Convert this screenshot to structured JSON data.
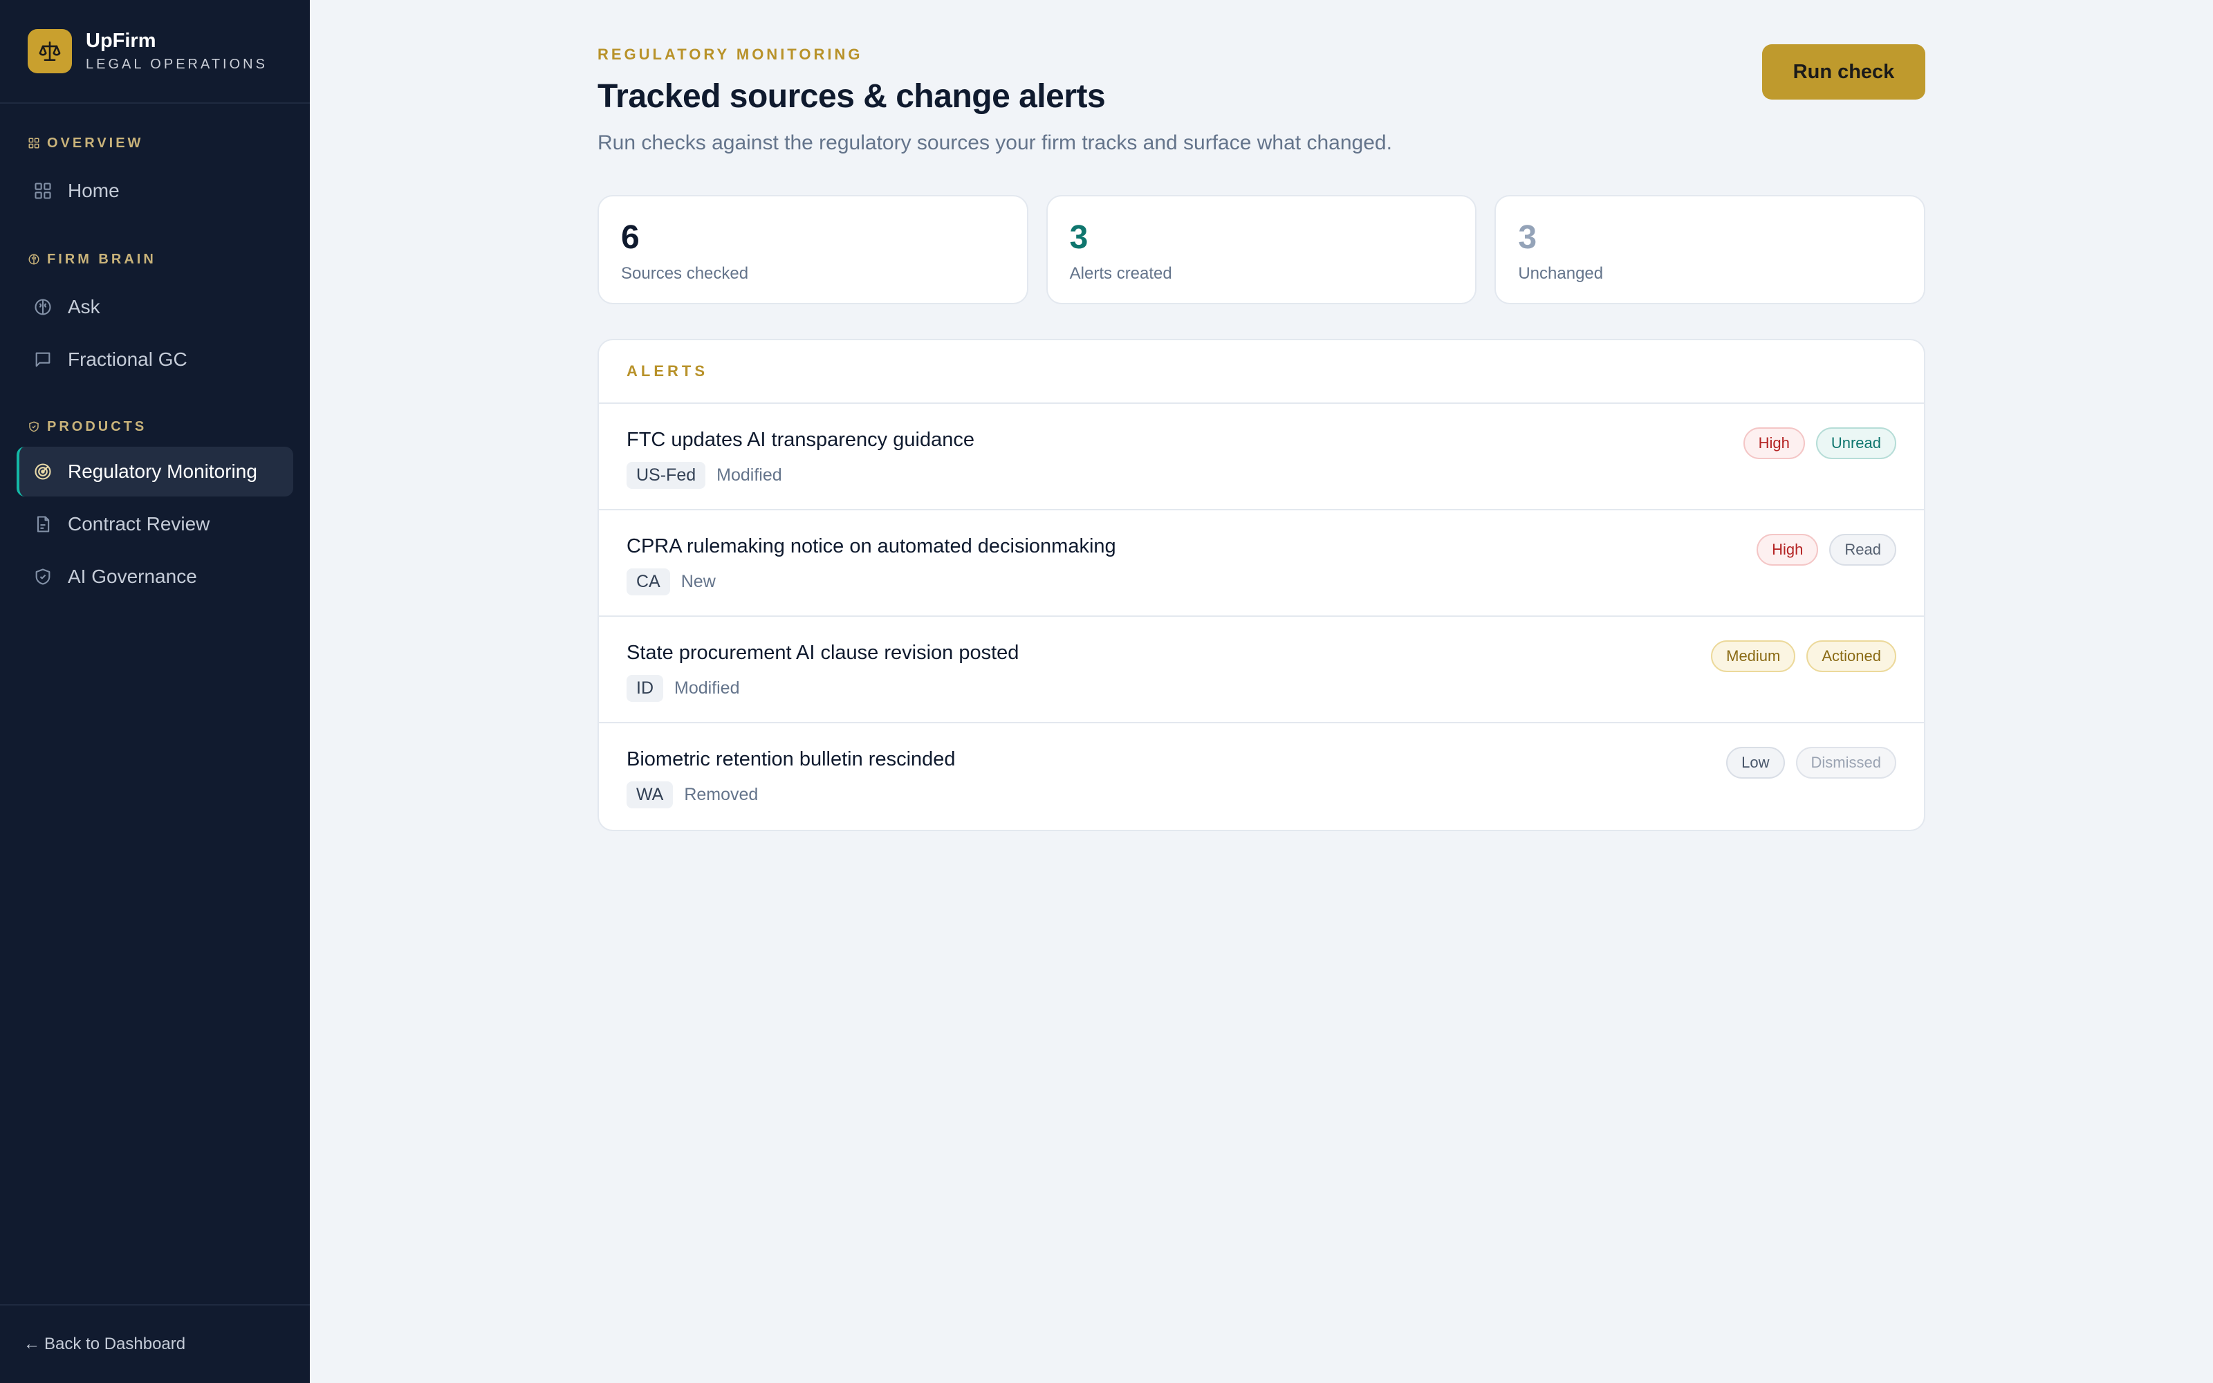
{
  "brand": {
    "name": "UpFirm",
    "subtitle": "LEGAL OPERATIONS"
  },
  "sidebar": {
    "sections": [
      {
        "header": "OVERVIEW",
        "items": [
          {
            "label": "Home",
            "icon": "grid-icon"
          }
        ]
      },
      {
        "header": "FIRM BRAIN",
        "items": [
          {
            "label": "Ask",
            "icon": "brain-icon"
          },
          {
            "label": "Fractional GC",
            "icon": "chat-icon"
          }
        ]
      },
      {
        "header": "PRODUCTS",
        "items": [
          {
            "label": "Regulatory Monitoring",
            "icon": "radar-icon",
            "active": true
          },
          {
            "label": "Contract Review",
            "icon": "document-icon"
          },
          {
            "label": "AI Governance",
            "icon": "shield-check-icon"
          }
        ]
      }
    ],
    "footer": "Back to Dashboard"
  },
  "header": {
    "eyebrow": "REGULATORY MONITORING",
    "title": "Tracked sources & change alerts",
    "description": "Run checks against the regulatory sources your firm tracks and surface what changed.",
    "run_button": "Run check"
  },
  "stats": [
    {
      "value": "6",
      "label": "Sources checked",
      "color": "#0f1a2e"
    },
    {
      "value": "3",
      "label": "Alerts created",
      "color": "#0f766e"
    },
    {
      "value": "3",
      "label": "Unchanged",
      "color": "#94a3b8"
    }
  ],
  "alerts": {
    "header": "ALERTS",
    "rows": [
      {
        "title": "FTC updates AI transparency guidance",
        "jurisdiction": "US-Fed",
        "change": "Modified",
        "severity": "High",
        "status": "Unread"
      },
      {
        "title": "CPRA rulemaking notice on automated decisionmaking",
        "jurisdiction": "CA",
        "change": "New",
        "severity": "High",
        "status": "Read"
      },
      {
        "title": "State procurement AI clause revision posted",
        "jurisdiction": "ID",
        "change": "Modified",
        "severity": "Medium",
        "status": "Actioned"
      },
      {
        "title": "Biometric retention bulletin rescinded",
        "jurisdiction": "WA",
        "change": "Removed",
        "severity": "Low",
        "status": "Dismissed"
      }
    ]
  },
  "colors": {
    "sidebar_bg": "#111b2f",
    "accent_gold": "#bf9a2d",
    "accent_teal": "#14b8a6"
  }
}
